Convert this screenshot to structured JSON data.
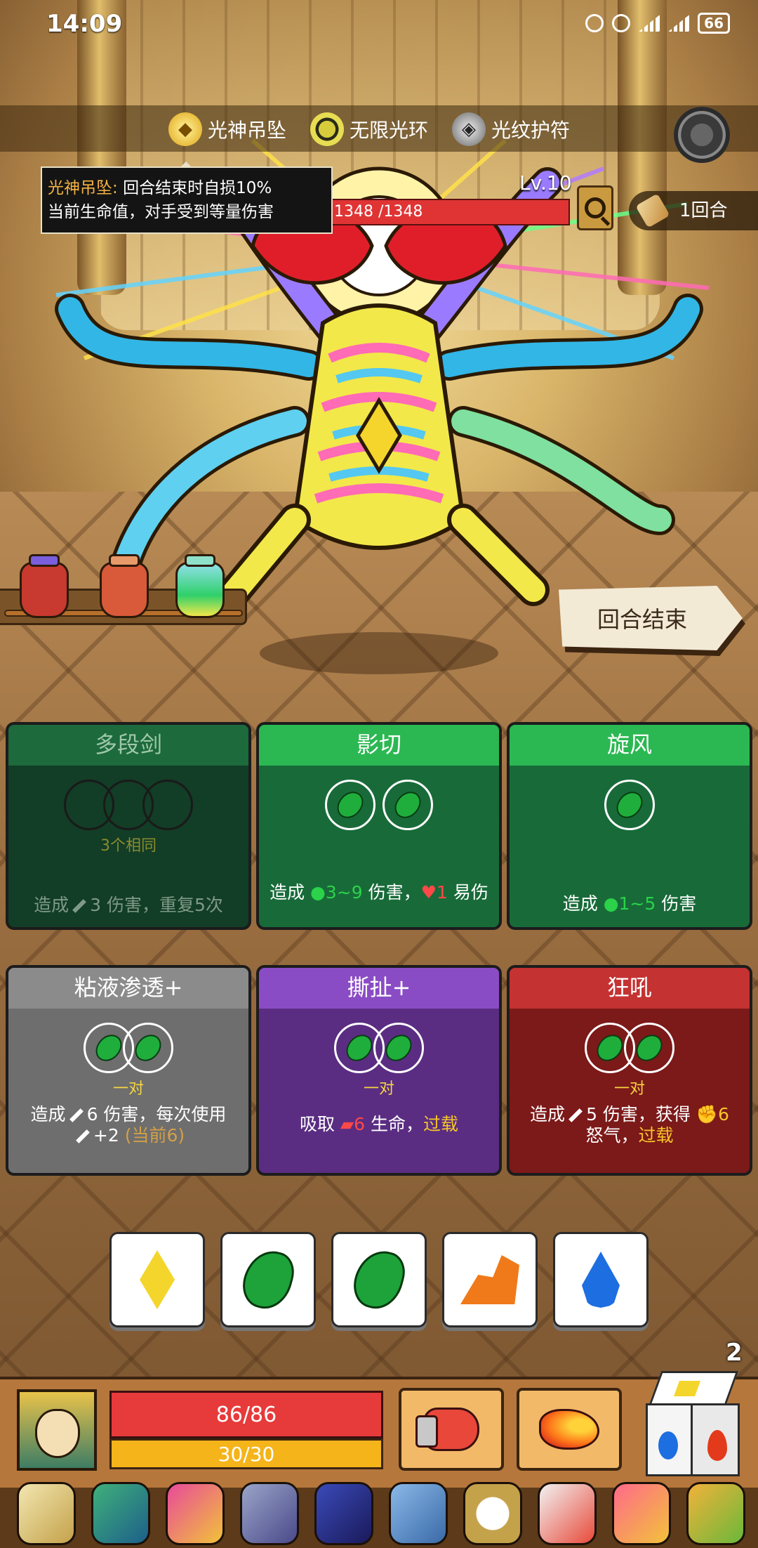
{
  "status_bar": {
    "time": "14:09",
    "battery": "66",
    "network": "5G 4G"
  },
  "relics": [
    {
      "name": "光神吊坠",
      "icon": "gold-pendant-icon"
    },
    {
      "name": "无限光环",
      "icon": "ring-icon"
    },
    {
      "name": "光纹护符",
      "icon": "amulet-icon"
    }
  ],
  "tooltip": {
    "name": "光神吊坠",
    "separator": ":",
    "line1_rest": "回合结束时自损10%",
    "line2": "当前生命值，对手受到等量伤害"
  },
  "enemy": {
    "level": "Lv.10",
    "hp_text": "1348 /1348",
    "hp_fraction": 1.0
  },
  "turn": {
    "label": "1回合"
  },
  "end_turn_label": "回合结束",
  "cards": [
    {
      "title": "多段剑",
      "requirement": "3个相同",
      "desc_before": "造成",
      "desc_value": "3",
      "desc_after": "伤害，重复5次",
      "state": "unavailable"
    },
    {
      "title": "影切",
      "desc_before": "造成",
      "desc_value": "3~9",
      "desc_mid": "伤害，",
      "desc_value2": "1",
      "desc_after": "易伤"
    },
    {
      "title": "旋风",
      "desc_before": "造成",
      "desc_value": "1~5",
      "desc_after": "伤害"
    },
    {
      "title": "粘液渗透+",
      "requirement": "一对",
      "desc_before": "造成",
      "desc_value": "6",
      "desc_mid": "伤害，每次使用",
      "desc_value2": "+2",
      "desc_after": "(当前6)"
    },
    {
      "title": "撕扯+",
      "requirement": "一对",
      "desc_before": "吸取",
      "desc_value": "6",
      "desc_mid": "生命，",
      "desc_after": "过载"
    },
    {
      "title": "狂吼",
      "requirement": "一对",
      "desc_before": "造成",
      "desc_value": "5",
      "desc_mid": "伤害，获得",
      "desc_value2": "6",
      "desc_line2": "怒气，",
      "desc_after": "过载"
    }
  ],
  "dice_hand": [
    "diamond",
    "leaf",
    "leaf",
    "rock",
    "drop"
  ],
  "player": {
    "hp_text": "86/86",
    "hp_fraction": 1.0,
    "shield_text": "30/30",
    "shield_fraction": 1.0
  },
  "dice_remaining": "2",
  "colors": {
    "hp_red": "#e73a3a",
    "energy_yellow": "#f4b41a",
    "card_green": "#186b39",
    "card_purple": "#5a2d82",
    "card_red": "#7c1919",
    "card_grey": "#6e6e6e"
  },
  "equipment_icons": [
    "banana-icon",
    "demon-mask-icon",
    "tribal-mask-icon",
    "helmet-icon",
    "cloak-icon",
    "rune-stone-icon",
    "mirror-icon",
    "spirit-mask-icon",
    "feather-icon",
    "pot-icon"
  ]
}
